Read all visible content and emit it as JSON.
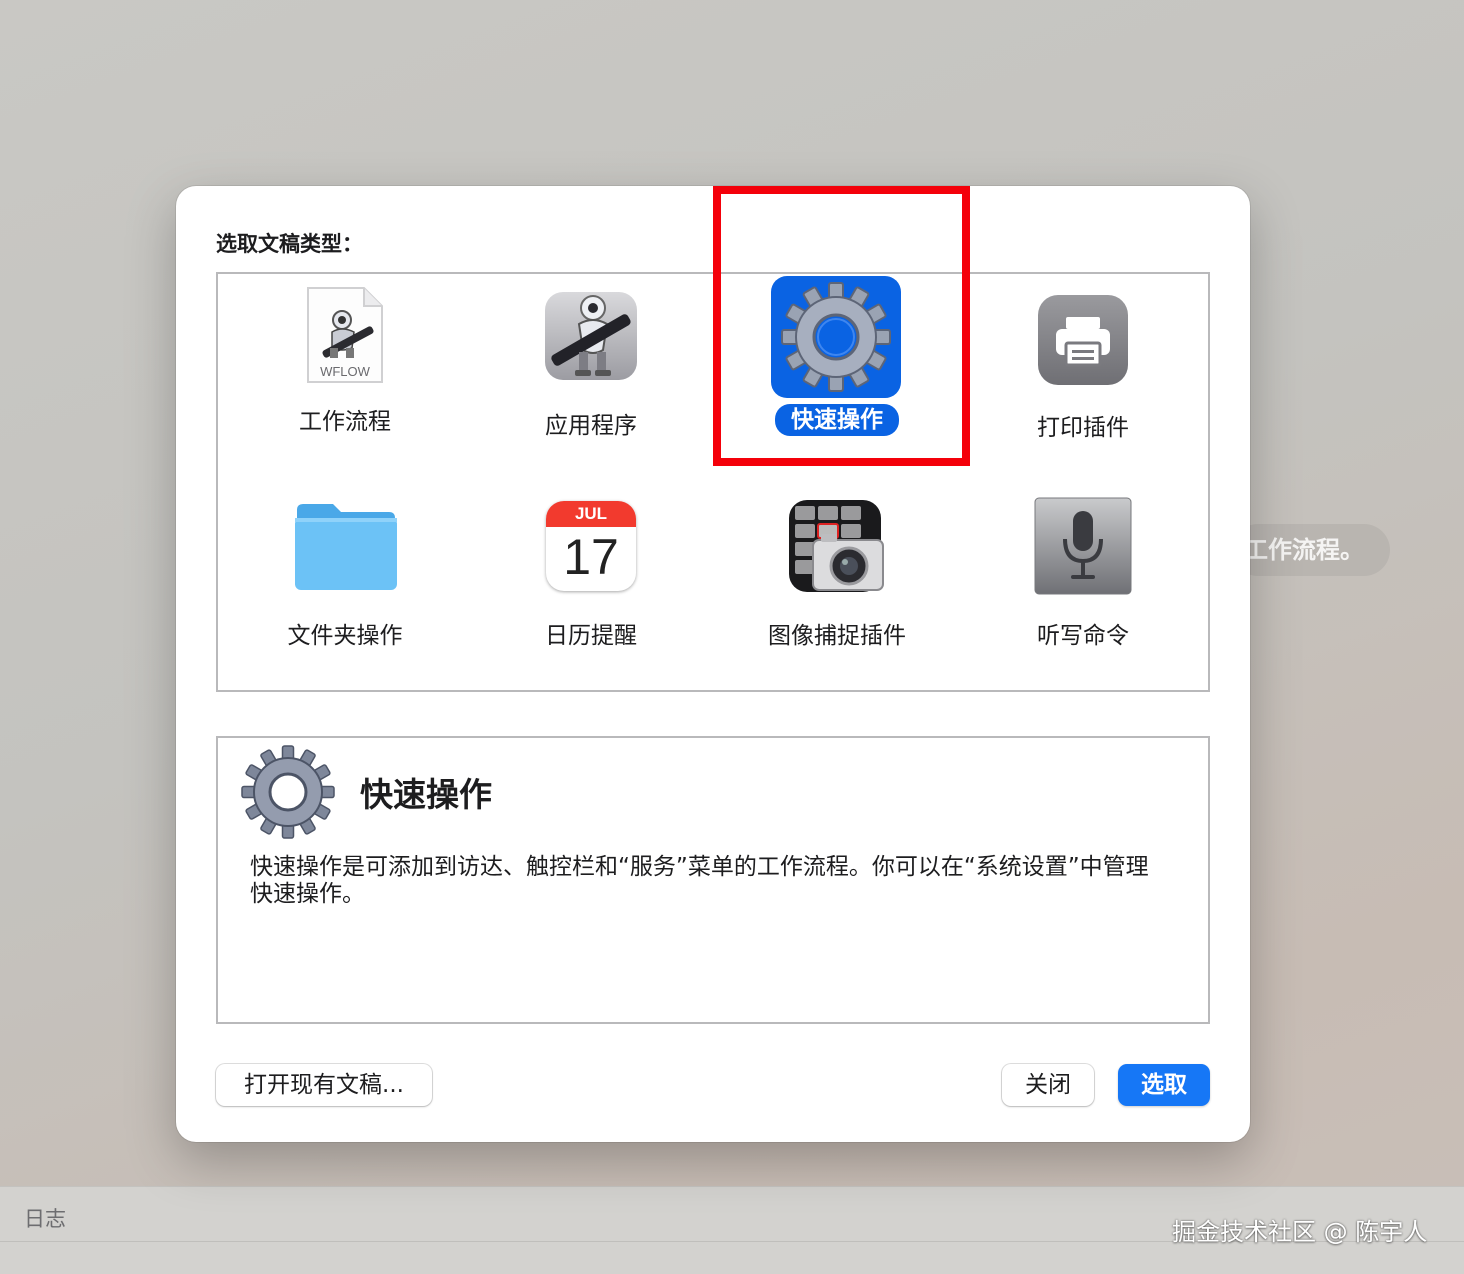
{
  "background": {
    "hint_text": "工作流程。",
    "log_label": "日志",
    "watermark": "掘金技术社区 @ 陈宇人"
  },
  "dialog": {
    "choose_label": "选取文稿类型：",
    "types": [
      {
        "label": "工作流程",
        "icon": "workflow-file-icon",
        "selected": false
      },
      {
        "label": "应用程序",
        "icon": "automator-robot-icon",
        "selected": false
      },
      {
        "label": "快速操作",
        "icon": "gear-icon",
        "selected": true
      },
      {
        "label": "打印插件",
        "icon": "printer-icon",
        "selected": false
      },
      {
        "label": "文件夹操作",
        "icon": "folder-icon",
        "selected": false
      },
      {
        "label": "日历提醒",
        "icon": "calendar-icon",
        "selected": false
      },
      {
        "label": "图像捕捉插件",
        "icon": "image-capture-icon",
        "selected": false
      },
      {
        "label": "听写命令",
        "icon": "microphone-icon",
        "selected": false
      }
    ],
    "workflow_file_ext": "WFLOW",
    "calendar": {
      "month": "JUL",
      "day": "17"
    },
    "description": {
      "title": "快速操作",
      "text": "快速操作是可添加到访达、触控栏和“服务”菜单的工作流程。你可以在“系统设置”中管理快速操作。"
    },
    "buttons": {
      "open_existing": "打开现有文稿...",
      "close": "关闭",
      "choose": "选取"
    }
  },
  "colors": {
    "accent": "#1677f6",
    "selection": "#0a63e3",
    "highlight_box": "#f4000a"
  }
}
